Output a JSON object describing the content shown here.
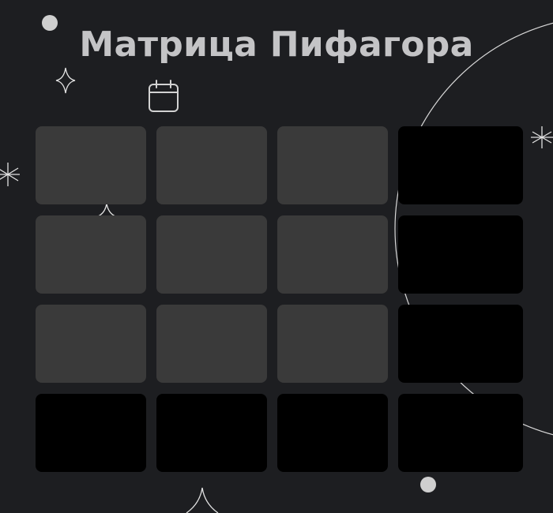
{
  "page": {
    "title": "Матрица Пифагора"
  },
  "toolbar": {
    "calendar_icon": "calendar-icon"
  },
  "matrix": {
    "rows": 4,
    "columns": 4,
    "colors": {
      "inner_cell": "#3a3a3a",
      "summary_cell": "#000000",
      "background": "#1d1e21",
      "title": "#c4c4c6"
    }
  },
  "decorations": {
    "icons": [
      "dot-icon",
      "sparkle-icon",
      "asterisk-icon",
      "orbit-circle"
    ]
  }
}
